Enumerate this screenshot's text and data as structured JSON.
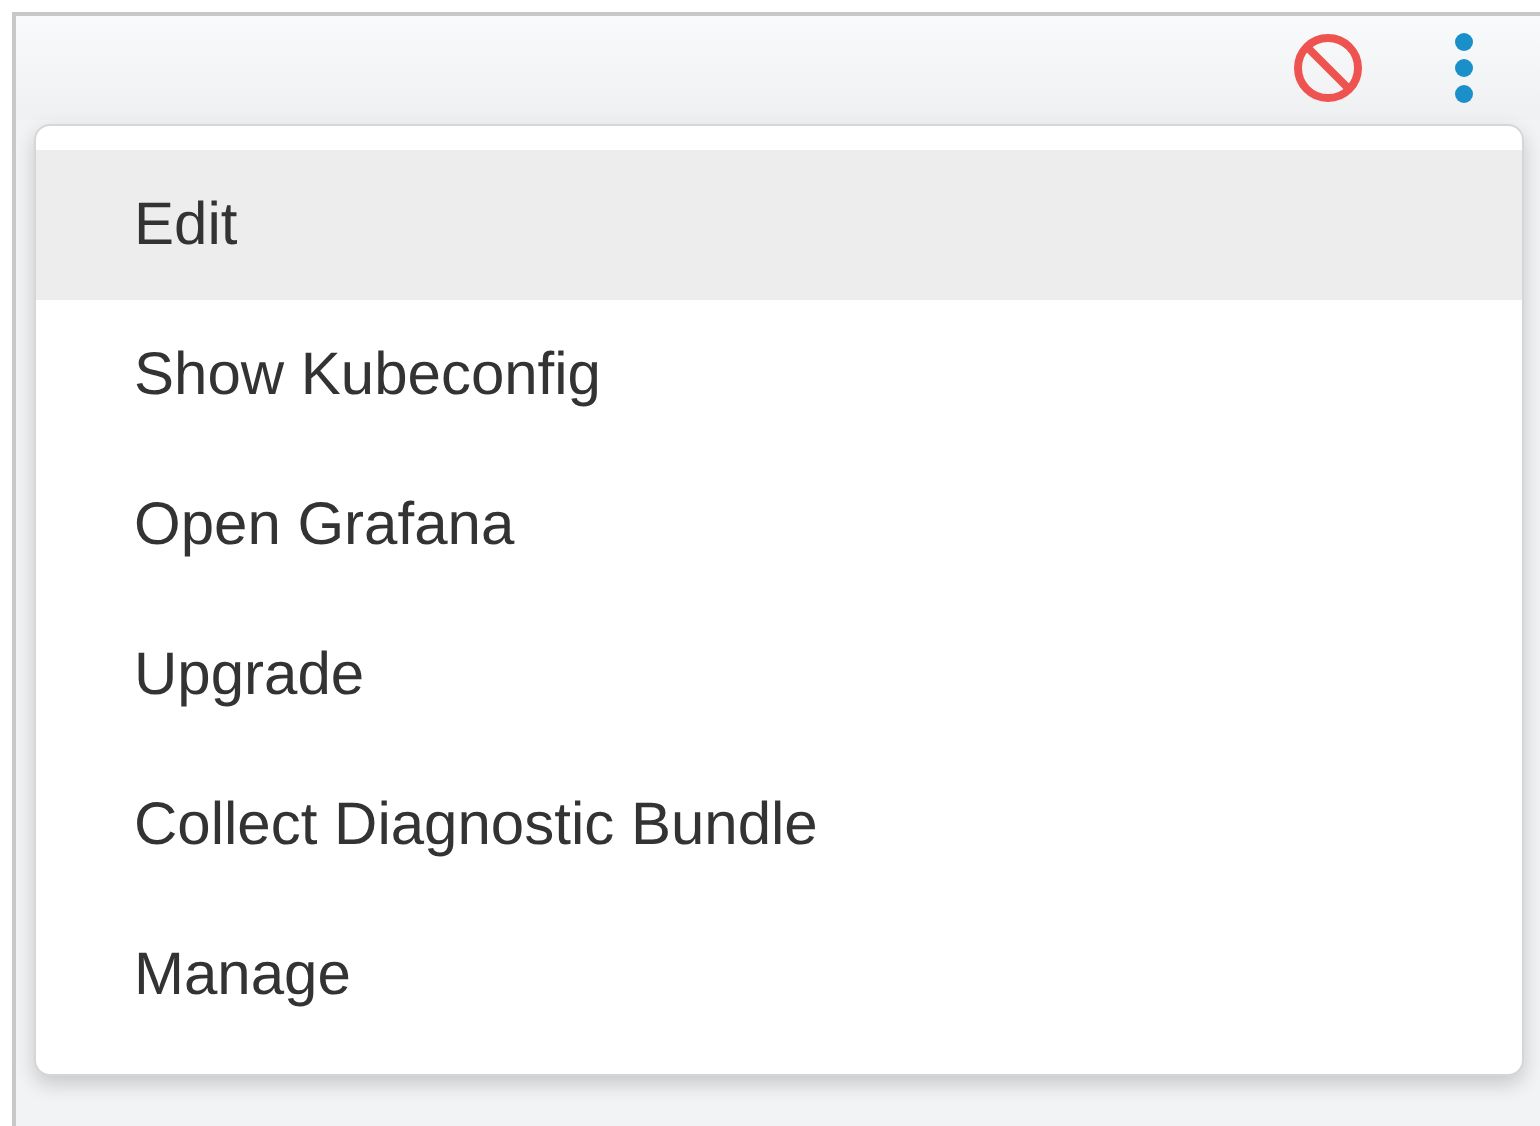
{
  "menu": {
    "items": [
      {
        "label": "Edit",
        "selected": true
      },
      {
        "label": "Show Kubeconfig",
        "selected": false
      },
      {
        "label": "Open Grafana",
        "selected": false
      },
      {
        "label": "Upgrade",
        "selected": false
      },
      {
        "label": "Collect Diagnostic Bundle",
        "selected": false
      },
      {
        "label": "Manage",
        "selected": false
      }
    ]
  }
}
